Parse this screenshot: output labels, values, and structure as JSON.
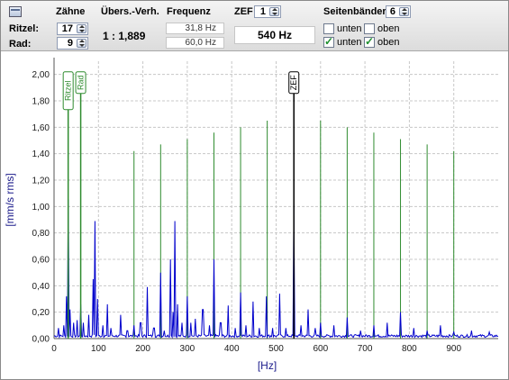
{
  "header": {
    "col_teeth": "Zähne",
    "col_ratio": "Übers.-Verh.",
    "col_freq": "Frequenz",
    "zef_label": "ZEF",
    "zef_value": "1",
    "sidebands_label": "Seitenbänder",
    "sidebands_value": "6"
  },
  "pinion": {
    "label": "Ritzel:",
    "teeth": "17",
    "freq": "31,8 Hz"
  },
  "gear": {
    "label": "Rad:",
    "teeth": "9",
    "freq": "60,0 Hz"
  },
  "ratio": "1 : 1,889",
  "zef_freq": "540 Hz",
  "checkboxes": {
    "row1": [
      {
        "label": "unten",
        "checked": false
      },
      {
        "label": "oben",
        "checked": false
      }
    ],
    "row2": [
      {
        "label": "unten",
        "checked": true
      },
      {
        "label": "oben",
        "checked": true
      }
    ]
  },
  "chart_data": {
    "type": "line",
    "xlabel": "[Hz]",
    "ylabel": "[mm/s rms]",
    "xlim": [
      0,
      1000
    ],
    "ylim": [
      0,
      2.1
    ],
    "x_ticks": [
      "0",
      "100",
      "200",
      "300",
      "400",
      "500",
      "600",
      "700",
      "800",
      "900"
    ],
    "y_ticks": [
      "0,00",
      "0,20",
      "0,40",
      "0,60",
      "0,80",
      "1,00",
      "1,20",
      "1,40",
      "1,60",
      "1,80",
      "2,00"
    ],
    "grid": true,
    "colors": {
      "spectrum": "#0000cc",
      "marker": "#2e8b2e",
      "zef_marker": "#000000",
      "grid": "#c8c8c8"
    },
    "markers": [
      {
        "label": "Ritzel",
        "x": 31.8,
        "top": 2.02,
        "color": "#2e8b2e"
      },
      {
        "label": "Rad",
        "x": 60.0,
        "top": 2.02,
        "color": "#2e8b2e"
      },
      {
        "label": "ZEF",
        "x": 540,
        "top": 2.02,
        "color": "#000000"
      }
    ],
    "sideband_lines": [
      {
        "x": 180,
        "top": 1.42
      },
      {
        "x": 240,
        "top": 1.47
      },
      {
        "x": 300,
        "top": 1.51
      },
      {
        "x": 360,
        "top": 1.56
      },
      {
        "x": 420,
        "top": 1.6
      },
      {
        "x": 480,
        "top": 1.65
      },
      {
        "x": 600,
        "top": 1.65
      },
      {
        "x": 660,
        "top": 1.6
      },
      {
        "x": 720,
        "top": 1.56
      },
      {
        "x": 780,
        "top": 1.51
      },
      {
        "x": 840,
        "top": 1.47
      },
      {
        "x": 900,
        "top": 1.42
      }
    ],
    "peaks": [
      {
        "x": 10,
        "y": 0.08
      },
      {
        "x": 22,
        "y": 0.1
      },
      {
        "x": 28,
        "y": 0.32
      },
      {
        "x": 31.8,
        "y": 1.05
      },
      {
        "x": 36,
        "y": 0.22
      },
      {
        "x": 44,
        "y": 0.12
      },
      {
        "x": 52,
        "y": 0.14
      },
      {
        "x": 60,
        "y": 0.26
      },
      {
        "x": 66,
        "y": 0.12
      },
      {
        "x": 78,
        "y": 0.18
      },
      {
        "x": 88,
        "y": 0.45
      },
      {
        "x": 92,
        "y": 0.89
      },
      {
        "x": 98,
        "y": 0.3
      },
      {
        "x": 110,
        "y": 0.1
      },
      {
        "x": 120,
        "y": 0.26
      },
      {
        "x": 128,
        "y": 0.08
      },
      {
        "x": 150,
        "y": 0.18
      },
      {
        "x": 165,
        "y": 0.06
      },
      {
        "x": 180,
        "y": 0.1
      },
      {
        "x": 195,
        "y": 0.12
      },
      {
        "x": 210,
        "y": 0.39
      },
      {
        "x": 225,
        "y": 0.08
      },
      {
        "x": 240,
        "y": 0.5
      },
      {
        "x": 248,
        "y": 0.06
      },
      {
        "x": 262,
        "y": 0.6
      },
      {
        "x": 268,
        "y": 0.2
      },
      {
        "x": 272,
        "y": 0.89
      },
      {
        "x": 278,
        "y": 0.26
      },
      {
        "x": 288,
        "y": 0.12
      },
      {
        "x": 300,
        "y": 0.32
      },
      {
        "x": 308,
        "y": 0.12
      },
      {
        "x": 318,
        "y": 0.15
      },
      {
        "x": 335,
        "y": 0.22
      },
      {
        "x": 350,
        "y": 0.1
      },
      {
        "x": 360,
        "y": 0.6
      },
      {
        "x": 375,
        "y": 0.12
      },
      {
        "x": 392,
        "y": 0.25
      },
      {
        "x": 408,
        "y": 0.08
      },
      {
        "x": 420,
        "y": 0.35
      },
      {
        "x": 432,
        "y": 0.1
      },
      {
        "x": 448,
        "y": 0.28
      },
      {
        "x": 462,
        "y": 0.08
      },
      {
        "x": 478,
        "y": 0.32
      },
      {
        "x": 492,
        "y": 0.08
      },
      {
        "x": 508,
        "y": 0.34
      },
      {
        "x": 522,
        "y": 0.08
      },
      {
        "x": 540,
        "y": 1.02
      },
      {
        "x": 556,
        "y": 0.1
      },
      {
        "x": 572,
        "y": 0.22
      },
      {
        "x": 588,
        "y": 0.08
      },
      {
        "x": 600,
        "y": 0.12
      },
      {
        "x": 630,
        "y": 0.1
      },
      {
        "x": 660,
        "y": 0.16
      },
      {
        "x": 690,
        "y": 0.06
      },
      {
        "x": 720,
        "y": 0.1
      },
      {
        "x": 750,
        "y": 0.12
      },
      {
        "x": 780,
        "y": 0.2
      },
      {
        "x": 810,
        "y": 0.08
      },
      {
        "x": 840,
        "y": 0.06
      },
      {
        "x": 870,
        "y": 0.1
      },
      {
        "x": 900,
        "y": 0.05
      },
      {
        "x": 940,
        "y": 0.06
      },
      {
        "x": 980,
        "y": 0.05
      }
    ]
  }
}
